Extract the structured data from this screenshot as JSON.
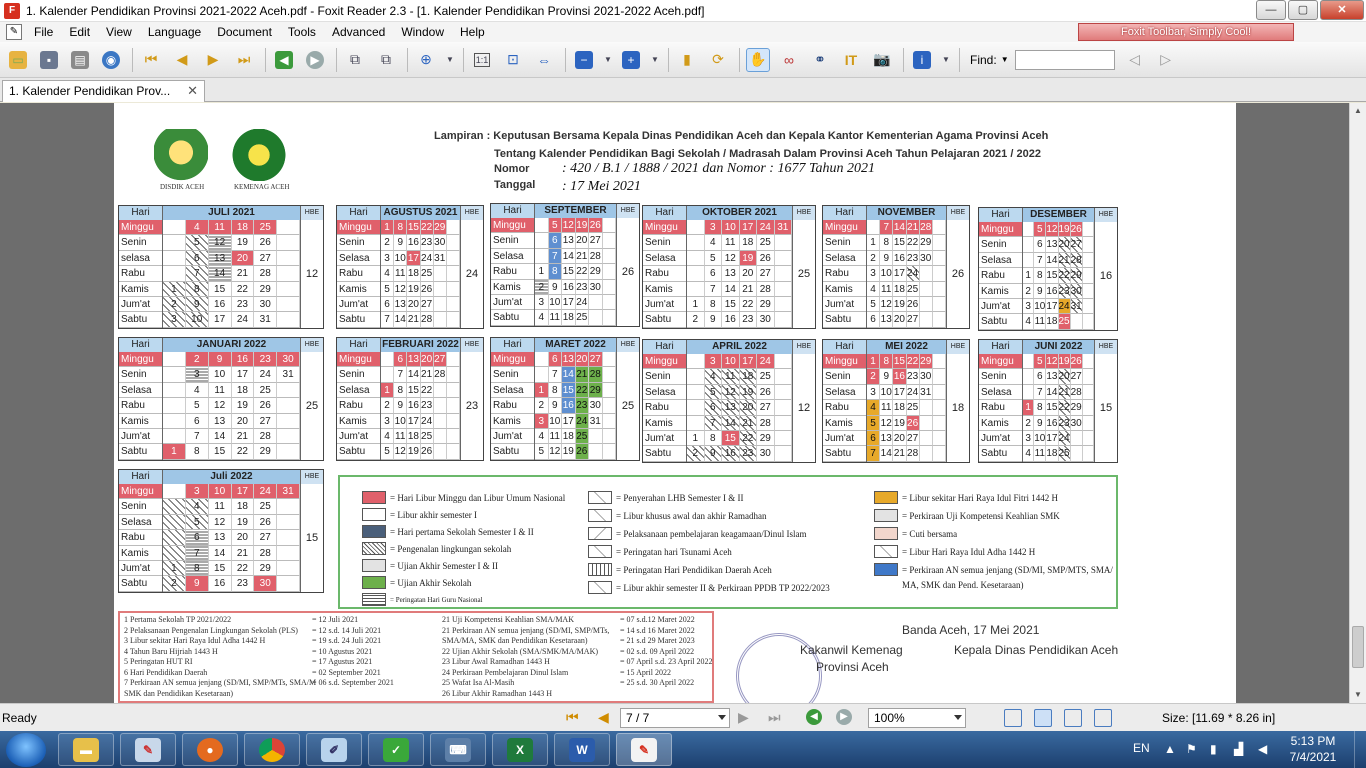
{
  "window": {
    "title": "1. Kalender Pendidikan Provinsi 2021-2022 Aceh.pdf - Foxit Reader 2.3 - [1. Kalender Pendidikan Provinsi 2021-2022 Aceh.pdf]",
    "minimize": "0",
    "restore": "▢",
    "close": "✕"
  },
  "menu": {
    "items": [
      "File",
      "Edit",
      "View",
      "Language",
      "Document",
      "Tools",
      "Advanced",
      "Window",
      "Help"
    ],
    "promo": "Foxit Toolbar, Simply Cool!"
  },
  "toolbar": {
    "find_label": "Find:",
    "find_value": ""
  },
  "tabs": [
    {
      "label": "1. Kalender Pendidikan Prov...",
      "close": "✕"
    }
  ],
  "document": {
    "lampiran": "Lampiran : Keputusan Bersama Kepala Dinas Pendidikan Aceh dan Kepala Kantor Kementerian Agama Provinsi Aceh",
    "tentang": "Tentang Kalender Pendidikan Bagi Sekolah / Madrasah Dalam Provinsi Aceh Tahun Pelajaran 2021 / 2022",
    "nomor_label": "Nomor",
    "nomor_value": ": 420 / B.1 / 1888 / 2021 dan Nomor : 1677 Tahun 2021",
    "tanggal_label": "Tanggal",
    "tanggal_value": ": 17 Mei 2021",
    "logo_left_caption": "DISDIK ACEH",
    "logo_right_caption": "KEMENAG ACEH",
    "hari_label": "Hari",
    "hbe_label": "HBE",
    "day_names": [
      "Minggu",
      "Senin",
      "Selasa",
      "Rabu",
      "Kamis",
      "Jum'at",
      "Sabtu"
    ],
    "day_names_first_row": [
      "Minggu",
      "Senin",
      "selasa",
      "Rabu",
      "Kamis",
      "Jum'at",
      "Sabtu"
    ],
    "months": [
      {
        "name": "JULI 2021",
        "hbe": "12",
        "rows": [
          [
            "",
            "4",
            "11",
            "18",
            "25",
            ""
          ],
          [
            "",
            "5",
            "12",
            "19",
            "26",
            ""
          ],
          [
            "",
            "6",
            "13",
            "20",
            "27",
            ""
          ],
          [
            "",
            "7",
            "14",
            "21",
            "28",
            ""
          ],
          [
            "1",
            "8",
            "15",
            "22",
            "29",
            ""
          ],
          [
            "2",
            "9",
            "16",
            "23",
            "30",
            ""
          ],
          [
            "3",
            "10",
            "17",
            "24",
            "31",
            ""
          ]
        ]
      },
      {
        "name": "AGUSTUS 2021",
        "hbe": "24",
        "rows": [
          [
            "1",
            "8",
            "15",
            "22",
            "29",
            ""
          ],
          [
            "2",
            "9",
            "16",
            "23",
            "30",
            ""
          ],
          [
            "3",
            "10",
            "17",
            "24",
            "31",
            ""
          ],
          [
            "4",
            "11",
            "18",
            "25",
            "",
            ""
          ],
          [
            "5",
            "12",
            "19",
            "26",
            "",
            ""
          ],
          [
            "6",
            "13",
            "20",
            "27",
            "",
            ""
          ],
          [
            "7",
            "14",
            "21",
            "28",
            "",
            ""
          ]
        ]
      },
      {
        "name": "SEPTEMBER 2021",
        "hbe": "26",
        "rows": [
          [
            "",
            "5",
            "12",
            "19",
            "26",
            ""
          ],
          [
            "",
            "6",
            "13",
            "20",
            "27",
            ""
          ],
          [
            "",
            "7",
            "14",
            "21",
            "28",
            ""
          ],
          [
            "1",
            "8",
            "15",
            "22",
            "29",
            ""
          ],
          [
            "2",
            "9",
            "16",
            "23",
            "30",
            ""
          ],
          [
            "3",
            "10",
            "17",
            "24",
            "",
            ""
          ],
          [
            "4",
            "11",
            "18",
            "25",
            "",
            ""
          ]
        ]
      },
      {
        "name": "OKTOBER 2021",
        "hbe": "25",
        "rows": [
          [
            "",
            "3",
            "10",
            "17",
            "24",
            "31"
          ],
          [
            "",
            "4",
            "11",
            "18",
            "25",
            ""
          ],
          [
            "",
            "5",
            "12",
            "19",
            "26",
            ""
          ],
          [
            "",
            "6",
            "13",
            "20",
            "27",
            ""
          ],
          [
            "",
            "7",
            "14",
            "21",
            "28",
            ""
          ],
          [
            "1",
            "8",
            "15",
            "22",
            "29",
            ""
          ],
          [
            "2",
            "9",
            "16",
            "23",
            "30",
            ""
          ]
        ]
      },
      {
        "name": "NOVEMBER 2021",
        "hbe": "26",
        "rows": [
          [
            "",
            "7",
            "14",
            "21",
            "28",
            ""
          ],
          [
            "1",
            "8",
            "15",
            "22",
            "29",
            ""
          ],
          [
            "2",
            "9",
            "16",
            "23",
            "30",
            ""
          ],
          [
            "3",
            "10",
            "17",
            "24",
            "",
            ""
          ],
          [
            "4",
            "11",
            "18",
            "25",
            "",
            ""
          ],
          [
            "5",
            "12",
            "19",
            "26",
            "",
            ""
          ],
          [
            "6",
            "13",
            "20",
            "27",
            "",
            ""
          ]
        ]
      },
      {
        "name": "DESEMBER 2021",
        "hbe": "16",
        "rows": [
          [
            "",
            "5",
            "12",
            "19",
            "26",
            ""
          ],
          [
            "",
            "6",
            "13",
            "20",
            "27",
            ""
          ],
          [
            "",
            "7",
            "14",
            "21",
            "28",
            ""
          ],
          [
            "1",
            "8",
            "15",
            "22",
            "29",
            ""
          ],
          [
            "2",
            "9",
            "16",
            "23",
            "30",
            ""
          ],
          [
            "3",
            "10",
            "17",
            "24",
            "31",
            ""
          ],
          [
            "4",
            "11",
            "18",
            "25",
            "",
            ""
          ]
        ]
      },
      {
        "name": "JANUARI 2022",
        "hbe": "25",
        "rows": [
          [
            "",
            "2",
            "9",
            "16",
            "23",
            "30"
          ],
          [
            "",
            "3",
            "10",
            "17",
            "24",
            "31"
          ],
          [
            "",
            "4",
            "11",
            "18",
            "25",
            ""
          ],
          [
            "",
            "5",
            "12",
            "19",
            "26",
            ""
          ],
          [
            "",
            "6",
            "13",
            "20",
            "27",
            ""
          ],
          [
            "",
            "7",
            "14",
            "21",
            "28",
            ""
          ],
          [
            "1",
            "8",
            "15",
            "22",
            "29",
            ""
          ]
        ]
      },
      {
        "name": "FEBRUARI 2022",
        "hbe": "23",
        "rows": [
          [
            "",
            "6",
            "13",
            "20",
            "27",
            ""
          ],
          [
            "",
            "7",
            "14",
            "21",
            "28",
            ""
          ],
          [
            "1",
            "8",
            "15",
            "22",
            "",
            ""
          ],
          [
            "2",
            "9",
            "16",
            "23",
            "",
            ""
          ],
          [
            "3",
            "10",
            "17",
            "24",
            "",
            ""
          ],
          [
            "4",
            "11",
            "18",
            "25",
            "",
            ""
          ],
          [
            "5",
            "12",
            "19",
            "26",
            "",
            ""
          ]
        ]
      },
      {
        "name": "MARET 2022",
        "hbe": "25",
        "rows": [
          [
            "",
            "6",
            "13",
            "20",
            "27",
            ""
          ],
          [
            "",
            "7",
            "14",
            "21",
            "28",
            ""
          ],
          [
            "1",
            "8",
            "15",
            "22",
            "29",
            ""
          ],
          [
            "2",
            "9",
            "16",
            "23",
            "30",
            ""
          ],
          [
            "3",
            "10",
            "17",
            "24",
            "31",
            ""
          ],
          [
            "4",
            "11",
            "18",
            "25",
            "",
            ""
          ],
          [
            "5",
            "12",
            "19",
            "26",
            "",
            ""
          ]
        ]
      },
      {
        "name": "APRIL 2022",
        "hbe": "12",
        "rows": [
          [
            "",
            "3",
            "10",
            "17",
            "24",
            ""
          ],
          [
            "",
            "4",
            "11",
            "18",
            "25",
            ""
          ],
          [
            "",
            "5",
            "12",
            "19",
            "26",
            ""
          ],
          [
            "",
            "6",
            "13",
            "20",
            "27",
            ""
          ],
          [
            "",
            "7",
            "14",
            "21",
            "28",
            ""
          ],
          [
            "1",
            "8",
            "15",
            "22",
            "29",
            ""
          ],
          [
            "2",
            "9",
            "16",
            "23",
            "30",
            ""
          ]
        ]
      },
      {
        "name": "MEI 2022",
        "hbe": "18",
        "rows": [
          [
            "1",
            "8",
            "15",
            "22",
            "29",
            ""
          ],
          [
            "2",
            "9",
            "16",
            "23",
            "30",
            ""
          ],
          [
            "3",
            "10",
            "17",
            "24",
            "31",
            ""
          ],
          [
            "4",
            "11",
            "18",
            "25",
            "",
            ""
          ],
          [
            "5",
            "12",
            "19",
            "26",
            "",
            ""
          ],
          [
            "6",
            "13",
            "20",
            "27",
            "",
            ""
          ],
          [
            "7",
            "14",
            "21",
            "28",
            "",
            ""
          ]
        ]
      },
      {
        "name": "JUNI 2022",
        "hbe": "15",
        "rows": [
          [
            "",
            "5",
            "12",
            "19",
            "26",
            ""
          ],
          [
            "",
            "6",
            "13",
            "20",
            "27",
            ""
          ],
          [
            "",
            "7",
            "14",
            "21",
            "28",
            ""
          ],
          [
            "1",
            "8",
            "15",
            "22",
            "29",
            ""
          ],
          [
            "2",
            "9",
            "16",
            "23",
            "30",
            ""
          ],
          [
            "3",
            "10",
            "17",
            "24",
            "",
            ""
          ],
          [
            "4",
            "11",
            "18",
            "25",
            "",
            ""
          ]
        ]
      },
      {
        "name": "Juli 2022",
        "hbe": "15",
        "rows": [
          [
            "",
            "3",
            "10",
            "17",
            "24",
            "31"
          ],
          [
            "",
            "4",
            "11",
            "18",
            "25",
            ""
          ],
          [
            "",
            "5",
            "12",
            "19",
            "26",
            ""
          ],
          [
            "",
            "6",
            "13",
            "20",
            "27",
            ""
          ],
          [
            "",
            "7",
            "14",
            "21",
            "28",
            ""
          ],
          [
            "1",
            "8",
            "15",
            "22",
            "29",
            ""
          ],
          [
            "2",
            "9",
            "16",
            "23",
            "30",
            ""
          ]
        ]
      }
    ],
    "legend": [
      "= Hari Libur Minggu dan Libur Umum Nasional",
      "= Libur akhir semester I",
      "= Hari pertama Sekolah Semester I & II",
      "= Pengenalan lingkungan sekolah",
      "= Ujian Akhir Semester I & II",
      "= Ujian Akhir Sekolah",
      "= Peringatan Hari Guru Nasional",
      "= Penyerahan LHB Semester I & II",
      "= Libur khusus awal dan akhir Ramadhan",
      "= Pelaksanaan pembelajaran keagamaan/Dinul Islam",
      "= Peringatan hari Tsunami Aceh",
      "= Peringatan Hari Pendidikan Daerah Aceh",
      "= Libur akhir semester II & Perkiraan PPDB TP 2022/2023",
      "= Libur sekitar Hari Raya Idul Fitri 1442 H",
      "= Perkiraan Uji Kompetensi Keahlian SMK",
      "= Cuti bersama",
      "= Libur Hari Raya Idul Adha 1442 H",
      "= Perkiraan AN semua jenjang (SD/MI, SMP/MTS, SMA/",
      "MA, SMK dan Pend. Kesetaraan)"
    ],
    "notes_left": [
      "1  Pertama Sekolah TP 2021/2022",
      "2  Pelaksanaan Pengenalan Lingkungan Sekolah (PLS)",
      "3  Libur sekitar Hari Raya Idul Adha 1442 H",
      "4  Tahun Baru Hijriah 1443 H",
      "5  Peringatan HUT RI",
      "6  Hari Pendidikan Daerah",
      "7  Perkiraan AN semua jenjang (SD/MI, SMP/MTs, SMA/M",
      "    SMK dan Pendidikan Kesetaraan)"
    ],
    "notes_left_values": [
      "= 12 Juli 2021",
      "= 12 s.d. 14 Juli 2021",
      "= 19 s.d. 24 Juli 2021",
      "= 10 Agustus 2021",
      "= 17 Agustus 2021",
      "= 02 September 2021",
      "= 06 s.d. September 2021"
    ],
    "notes_right": [
      "21  Uji Kompetensi Keahlian SMA/MAK",
      "21  Perkiraan AN semua jenjang (SD/MI, SMP/MTs,",
      "     SMA/MA, SMK dan Pendidikan Kesetaraan)",
      "22  Ujian Akhir Sekolah (SMA/SMK/MA/MAK)",
      "23  Libur Awal Ramadhan 1443 H",
      "24  Perkiraan Pembelajaran Dinul Islam",
      "25  Wafat Isa Al-Masih",
      "26  Libur Akhir Ramadhan 1443 H"
    ],
    "notes_right_values": [
      "= 07 s.d.12 Maret 2022",
      "= 14 s.d 16 Maret 2022",
      "= 21 s.d 29 Maret 2023",
      "= 02 s.d. 09 April 2022",
      "= 07 April s.d. 23 April 2022",
      "= 15 April 2022",
      "= 25 s.d. 30 April 2022"
    ],
    "place_date": "Banda Aceh, 17 Mei 2021",
    "signer_left_1": "Kakanwil Kemenag",
    "signer_left_2": "Provinsi Aceh",
    "signer_right": "Kepala Dinas Pendidikan Aceh"
  },
  "statusbar": {
    "ready": "Ready",
    "page_display": "7 / 7",
    "zoom": "100%",
    "size": "Size: [11.69 * 8.26 in]"
  },
  "taskbar": {
    "lang": "EN",
    "time": "5:13 PM",
    "date": "7/4/2021"
  }
}
